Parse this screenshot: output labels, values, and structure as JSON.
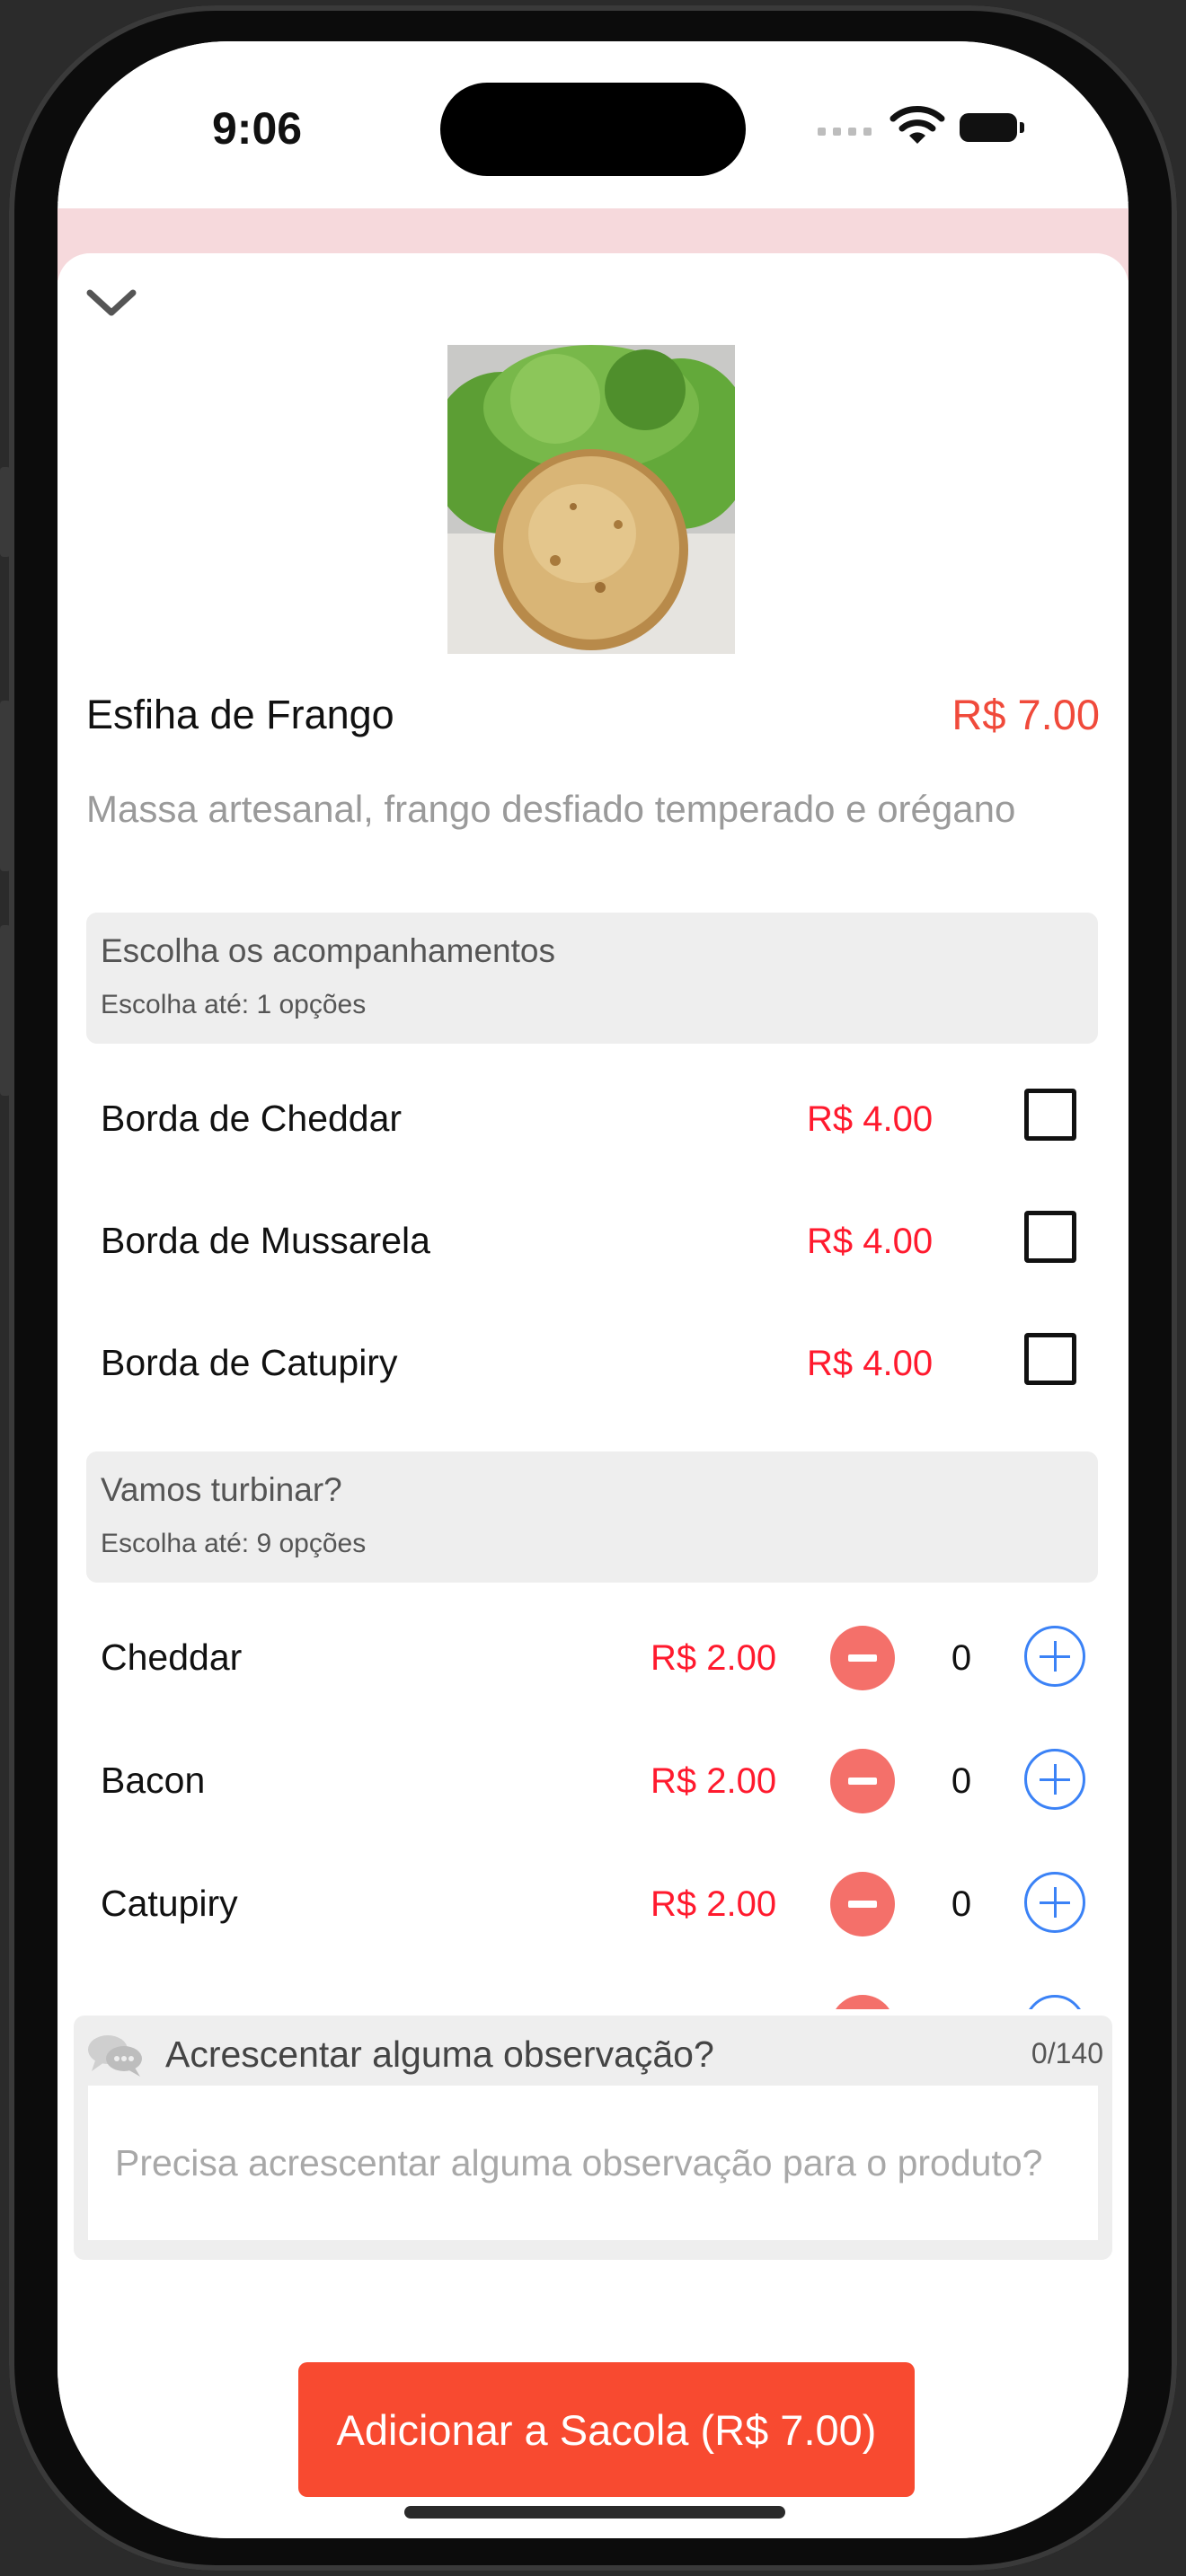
{
  "status_bar": {
    "time": "9:06"
  },
  "product": {
    "name": "Esfiha de Frango",
    "price": "R$ 7.00",
    "description": "Massa artesanal, frango desfiado temperado e orégano"
  },
  "groups": [
    {
      "title": "Escolha os acompanhamentos",
      "subtitle": "Escolha até: 1 opções",
      "items": [
        {
          "name": "Borda de Cheddar",
          "price": "R$ 4.00",
          "checked": false
        },
        {
          "name": "Borda de Mussarela",
          "price": "R$ 4.00",
          "checked": false
        },
        {
          "name": "Borda de Catupiry",
          "price": "R$ 4.00",
          "checked": false
        }
      ]
    },
    {
      "title": "Vamos turbinar?",
      "subtitle": "Escolha até: 9 opções",
      "items": [
        {
          "name": "Cheddar",
          "price": "R$ 2.00",
          "qty": "0"
        },
        {
          "name": "Bacon",
          "price": "R$ 2.00",
          "qty": "0"
        },
        {
          "name": "Catupiry",
          "price": "R$ 2.00",
          "qty": "0"
        }
      ]
    }
  ],
  "observation": {
    "title": "Acrescentar alguma observação?",
    "counter": "0/140",
    "placeholder": "Precisa acrescentar alguma observação para o produto?"
  },
  "cta": {
    "label": "Adicionar a Sacola (R$ 7.00)"
  },
  "colors": {
    "accent": "#f84a30",
    "price": "#f04a3b",
    "minus": "#f4706a",
    "plus": "#3b82f6"
  }
}
